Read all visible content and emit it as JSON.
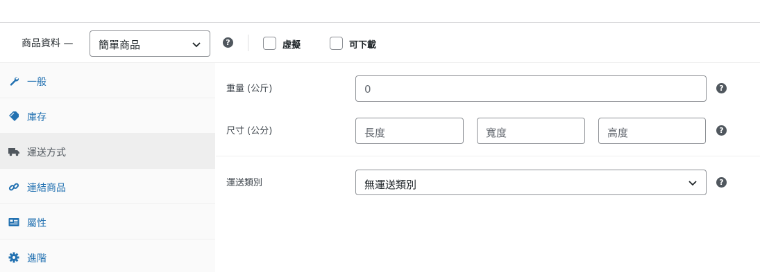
{
  "header": {
    "label": "商品資料 —",
    "product_type": "簡單商品",
    "help": "?",
    "virtual_label": "虛擬",
    "downloadable_label": "可下載"
  },
  "sidebar": {
    "items": [
      {
        "label": "一般",
        "icon": "wrench-icon"
      },
      {
        "label": "庫存",
        "icon": "tag-icon"
      },
      {
        "label": "運送方式",
        "icon": "truck-icon",
        "active": true
      },
      {
        "label": "連結商品",
        "icon": "link-icon"
      },
      {
        "label": "屬性",
        "icon": "attributes-card-icon"
      },
      {
        "label": "進階",
        "icon": "gear-icon"
      }
    ]
  },
  "shipping": {
    "weight_label": "重量 (公斤)",
    "weight_placeholder": "0",
    "dimensions_label": "尺寸 (公分)",
    "length_placeholder": "長度",
    "width_placeholder": "寬度",
    "height_placeholder": "高度",
    "class_label": "運送類別",
    "class_value": "無運送類別"
  },
  "colors": {
    "link": "#2271b1",
    "active_tab_bg": "#eeeeee",
    "sidebar_bg": "#fafafa",
    "border": "#8c8f94",
    "help_icon": "#50575e"
  }
}
